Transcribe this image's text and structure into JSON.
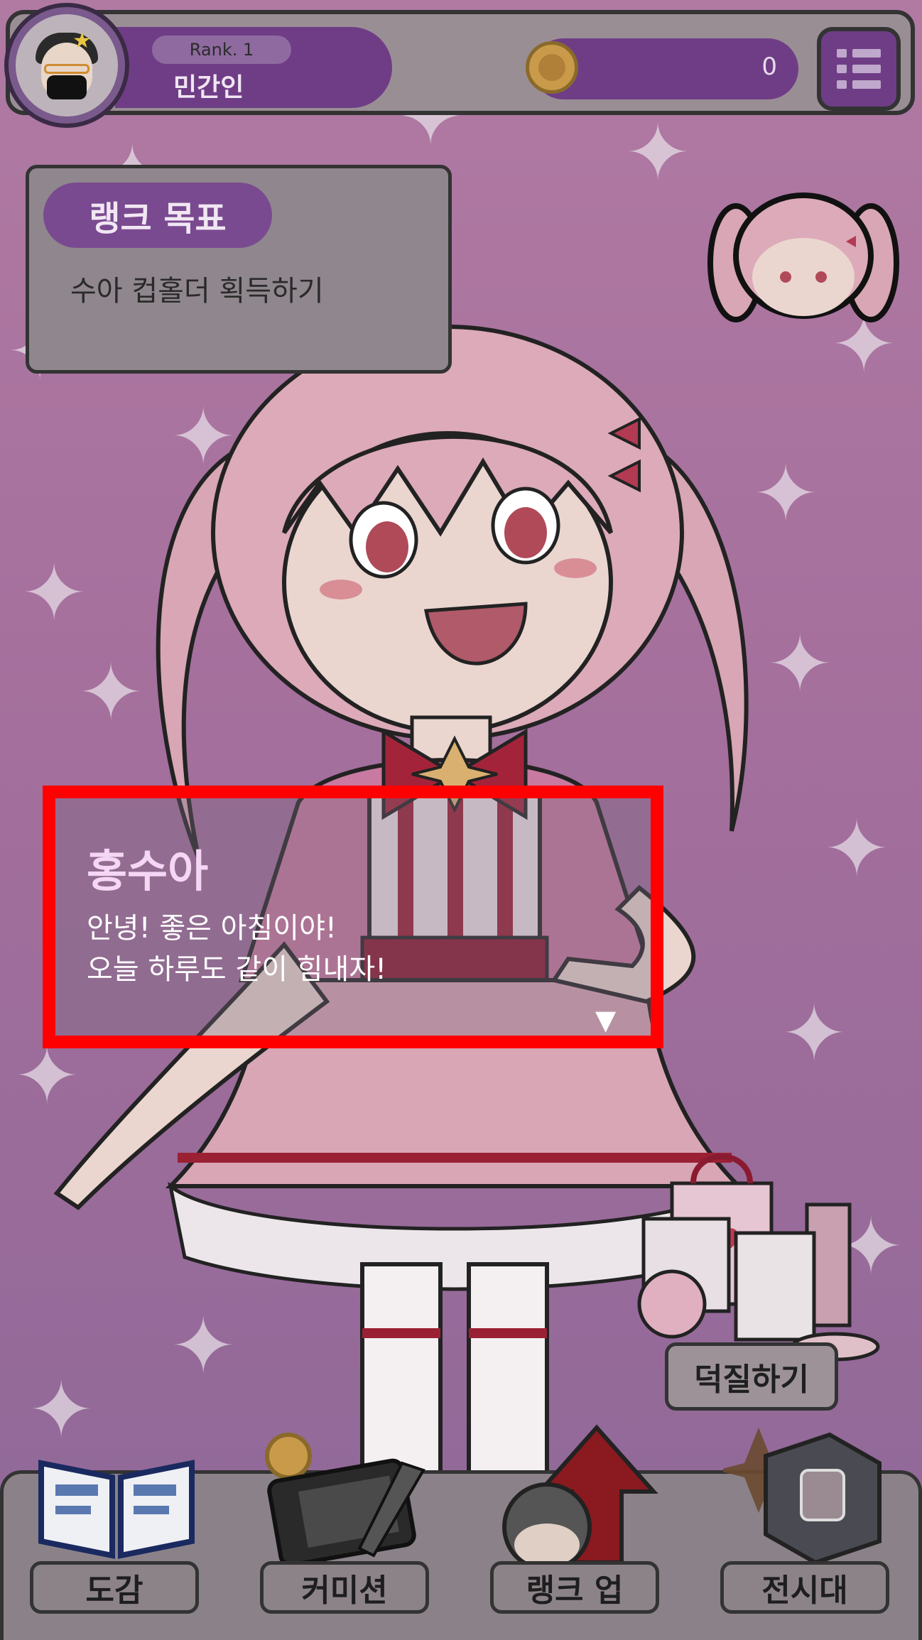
{
  "top_bar": {
    "rank_label": "Rank. 1",
    "rank_name": "민간인",
    "coins": "0"
  },
  "rank_goal": {
    "title": "랭크 목표",
    "text": "수아 컵홀더 획득하기"
  },
  "dialogue": {
    "speaker": "홍수아",
    "line1": "안녕! 좋은 아침이야!",
    "line2": "오늘 하루도 같이 힘내자!",
    "next": "▼"
  },
  "side_action": {
    "label": "덕질하기"
  },
  "nav": {
    "items": [
      {
        "label": "도감",
        "icon": "book-icon"
      },
      {
        "label": "커미션",
        "icon": "drawing-tablet-icon"
      },
      {
        "label": "랭크 업",
        "icon": "rank-up-arrow-icon"
      },
      {
        "label": "전시대",
        "icon": "display-case-icon"
      }
    ]
  },
  "colors": {
    "accent_purple": "#6f3d86",
    "highlight_red": "#ff0000",
    "background_pink": "#a46f9c"
  }
}
